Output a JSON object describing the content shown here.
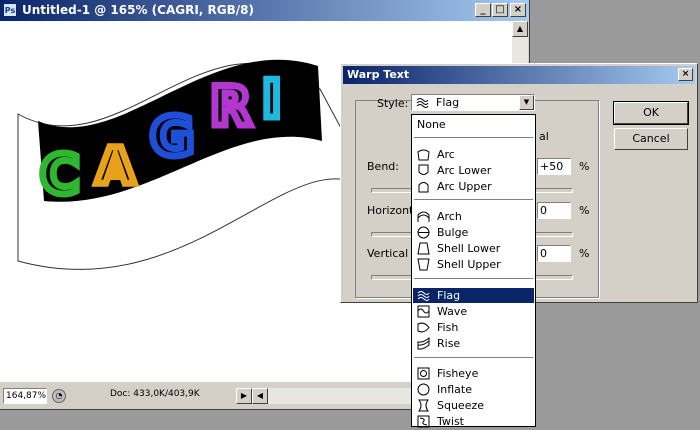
{
  "document": {
    "title": "Untitled-1 @ 165% (CAGRI, RGB/8)",
    "app_icon": "Ps",
    "zoom": "164,87%",
    "doc_info": "Doc: 433,0K/403,9K",
    "artwork_text": "CAGRI",
    "letter_colors": [
      "#2fb82f",
      "#e8a21a",
      "#1f4fd8",
      "#b436d0",
      "#1fb8e0"
    ]
  },
  "dialog": {
    "title": "Warp Text",
    "style_label": "Style:",
    "style_value": "Flag",
    "partial_label": "al",
    "bend_label": "Bend:",
    "bend_value": "+50",
    "bend_unit": "%",
    "horizontal_label": "Horizont",
    "horizontal_value": "0",
    "horizontal_unit": "%",
    "vertical_label": "Vertical",
    "vertical_value": "0",
    "vertical_unit": "%",
    "ok_label": "OK",
    "cancel_label": "Cancel"
  },
  "style_menu": [
    {
      "label": "None",
      "icon": "none"
    },
    {
      "label": "Arc",
      "icon": "arc-icon"
    },
    {
      "label": "Arc Lower",
      "icon": "arc-lower-icon"
    },
    {
      "label": "Arc Upper",
      "icon": "arc-upper-icon"
    },
    {
      "label": "Arch",
      "icon": "arch-icon"
    },
    {
      "label": "Bulge",
      "icon": "bulge-icon"
    },
    {
      "label": "Shell Lower",
      "icon": "shell-lower-icon"
    },
    {
      "label": "Shell Upper",
      "icon": "shell-upper-icon"
    },
    {
      "label": "Flag",
      "icon": "flag-icon",
      "selected": true
    },
    {
      "label": "Wave",
      "icon": "wave-icon"
    },
    {
      "label": "Fish",
      "icon": "fish-icon"
    },
    {
      "label": "Rise",
      "icon": "rise-icon"
    },
    {
      "label": "Fisheye",
      "icon": "fisheye-icon"
    },
    {
      "label": "Inflate",
      "icon": "inflate-icon"
    },
    {
      "label": "Squeeze",
      "icon": "squeeze-icon"
    },
    {
      "label": "Twist",
      "icon": "twist-icon"
    }
  ],
  "colors": {
    "title_active": "#0a246a",
    "selection": "#0a246a",
    "chrome": "#d4d0c8"
  }
}
